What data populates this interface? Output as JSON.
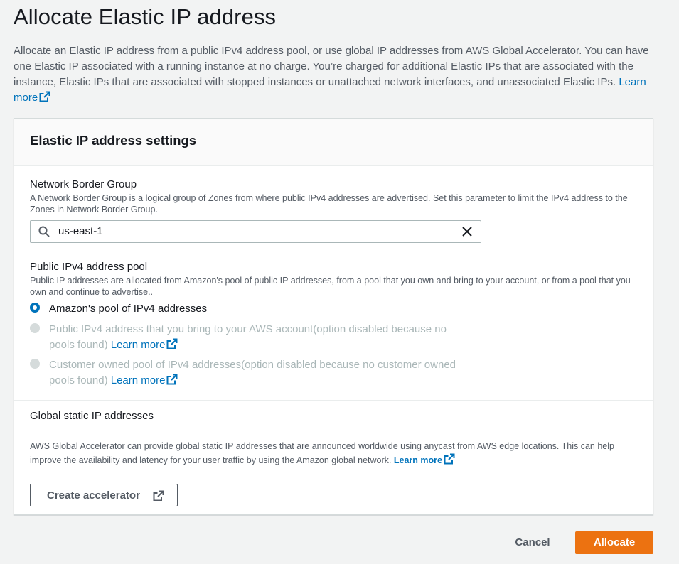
{
  "page": {
    "title": "Allocate Elastic IP address",
    "description": "Allocate an Elastic IP address from a public IPv4 address pool, or use global IP addresses from AWS Global Accelerator. You can have one Elastic IP associated with a running instance at no charge. You’re charged for additional Elastic IPs that are associated with the instance, Elastic IPs that are associated with stopped instances or unattached network interfaces, and unassociated Elastic IPs.",
    "learn_more": "Learn more"
  },
  "settings": {
    "heading": "Elastic IP address settings",
    "border_group": {
      "label": "Network Border Group",
      "description": "A Network Border Group is a logical group of Zones from where public IPv4 addresses are advertised. Set this parameter to limit the IPv4 address to the Zones in Network Border Group.",
      "value": "us-east-1"
    },
    "pool": {
      "label": "Public IPv4 address pool",
      "description": "Public IP addresses are allocated from Amazon's pool of public IP addresses, from a pool that you own and bring to your account, or from a pool that you own and continue to advertise..",
      "options": [
        {
          "line1": "Amazon's pool of IPv4 addresses",
          "line2": "",
          "selected": true,
          "disabled": false
        },
        {
          "line1": "Public IPv4 address that you bring to your AWS account(option disabled because no",
          "line2": "pools found)",
          "selected": false,
          "disabled": true
        },
        {
          "line1": "Customer owned pool of IPv4 addresses(option disabled because no customer owned",
          "line2": "pools found)",
          "selected": false,
          "disabled": true
        }
      ],
      "learn_more": "Learn more"
    },
    "global": {
      "label": "Global static IP addresses",
      "description": "AWS Global Accelerator can provide global static IP addresses that are announced worldwide using anycast from AWS edge locations. This can help improve the availability and latency for your user traffic by using the Amazon global network.",
      "learn_more": "Learn more",
      "button": "Create accelerator"
    }
  },
  "footer": {
    "cancel": "Cancel",
    "allocate": "Allocate"
  },
  "colors": {
    "primary": "#ec7211",
    "link": "#0073bb",
    "radio_selected": "#0073bb",
    "disabled_text": "#aab7b8"
  }
}
